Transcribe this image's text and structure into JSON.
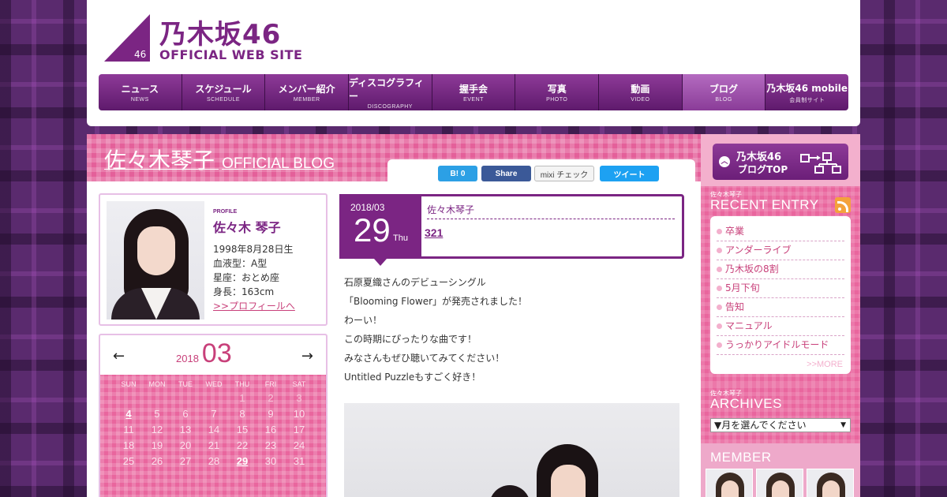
{
  "site": {
    "logo_number": "46",
    "logo_ja": "乃木坂46",
    "logo_en": "OFFICIAL WEB SITE"
  },
  "nav": [
    {
      "label": "ニュース",
      "sub": "NEWS",
      "active": false
    },
    {
      "label": "スケジュール",
      "sub": "SCHEDULE",
      "active": false
    },
    {
      "label": "メンバー紹介",
      "sub": "MEMBER",
      "active": false
    },
    {
      "label": "ディスコグラフィー",
      "sub": "DISCOGRAPHY",
      "active": false
    },
    {
      "label": "握手会",
      "sub": "EVENT",
      "active": false
    },
    {
      "label": "写真",
      "sub": "PHOTO",
      "active": false
    },
    {
      "label": "動画",
      "sub": "VIDEO",
      "active": false
    },
    {
      "label": "ブログ",
      "sub": "BLOG",
      "active": true
    },
    {
      "label": "乃木坂46 mobile",
      "sub": "会員制サイト",
      "active": false
    }
  ],
  "blog": {
    "name": "佐々木琴子",
    "sub": "OFFICIAL BLOG"
  },
  "share": {
    "hatena": "B! 0",
    "facebook": "Share",
    "mixi": "mixi チェック",
    "twitter": "ツイート"
  },
  "profile": {
    "label": "PROFILE",
    "name": "佐々木 琴子",
    "birth": "1998年8月28日生",
    "blood": "血液型：A型",
    "zodiac": "星座：おとめ座",
    "height": "身長：163cm",
    "link": ">>プロフィールへ"
  },
  "calendar": {
    "year": "2018",
    "month": "03",
    "prev": "←",
    "next": "→",
    "days_of_week": [
      "SUN",
      "MON",
      "TUE",
      "WED",
      "THU",
      "FRI",
      "SAT"
    ],
    "weeks": [
      [
        "",
        "",
        "",
        "",
        "1",
        "2",
        "3"
      ],
      [
        "4",
        "5",
        "6",
        "7",
        "8",
        "9",
        "10"
      ],
      [
        "11",
        "12",
        "13",
        "14",
        "15",
        "16",
        "17"
      ],
      [
        "18",
        "19",
        "20",
        "21",
        "22",
        "23",
        "24"
      ],
      [
        "25",
        "26",
        "27",
        "28",
        "29",
        "30",
        "31"
      ]
    ],
    "linked_days": [
      "4",
      "29"
    ]
  },
  "entry": {
    "year_month": "2018/03",
    "day": "29",
    "weekday": "Thu",
    "author": "佐々木琴子",
    "title": "321",
    "body": [
      "石原夏織さんのデビューシングル",
      "「Blooming Flower」が発売されました！",
      "わーい！",
      "この時期にぴったりな曲です！",
      "みなさんもぜひ聴いてみてください！",
      "Untitled Puzzleもすごく好き！"
    ]
  },
  "sidebar": {
    "blogtop_line1": "乃木坂46",
    "blogtop_line2": "ブログTOP",
    "recent_small": "佐々木琴子",
    "recent_title": "RECENT ENTRY",
    "recent_items": [
      "卒業",
      "アンダーライブ",
      "乃木坂の8割",
      "5月下旬",
      "告知",
      "マニュアル",
      "うっかりアイドルモード"
    ],
    "recent_more": ">>MORE",
    "archives_small": "佐々木琴子",
    "archives_title": "ARCHIVES",
    "archives_select": "▼月を選んでください",
    "member_title": "MEMBER"
  },
  "colors": {
    "brand_purple": "#7b2583",
    "pink": "#e9669e",
    "light_pink": "#f3b0cd"
  }
}
